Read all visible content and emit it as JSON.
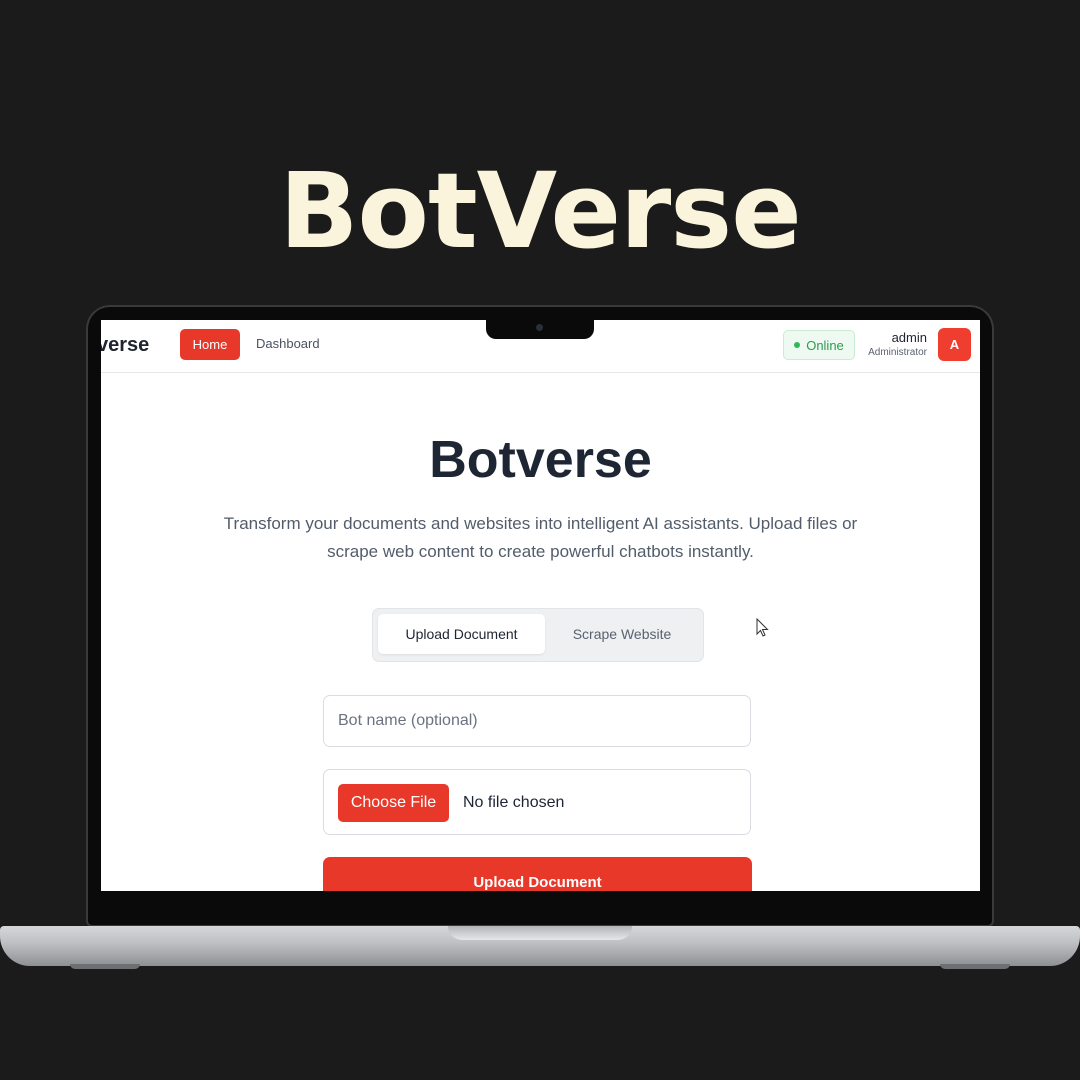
{
  "promo": {
    "title": "BotVerse"
  },
  "header": {
    "brand": "verse",
    "nav": {
      "home": "Home",
      "dashboard": "Dashboard"
    },
    "status": "Online",
    "user": {
      "name": "admin",
      "role": "Administrator",
      "avatar_initial": "A"
    }
  },
  "hero": {
    "title": "Botverse",
    "description": "Transform your documents and websites into intelligent AI assistants. Upload files or scrape web content to create powerful chatbots instantly."
  },
  "tabs": {
    "upload": "Upload Document",
    "scrape": "Scrape Website",
    "active": "upload"
  },
  "form": {
    "bot_name_placeholder": "Bot name (optional)",
    "choose_file_label": "Choose File",
    "file_status": "No file chosen",
    "submit_label": "Upload Document"
  },
  "colors": {
    "accent": "#e8382a",
    "online": "#2f9a53",
    "promo_title": "#fbf4dc",
    "background": "#1b1b1b"
  },
  "icons": [
    "status-dot-icon",
    "mouse-cursor-icon",
    "camera-icon"
  ]
}
